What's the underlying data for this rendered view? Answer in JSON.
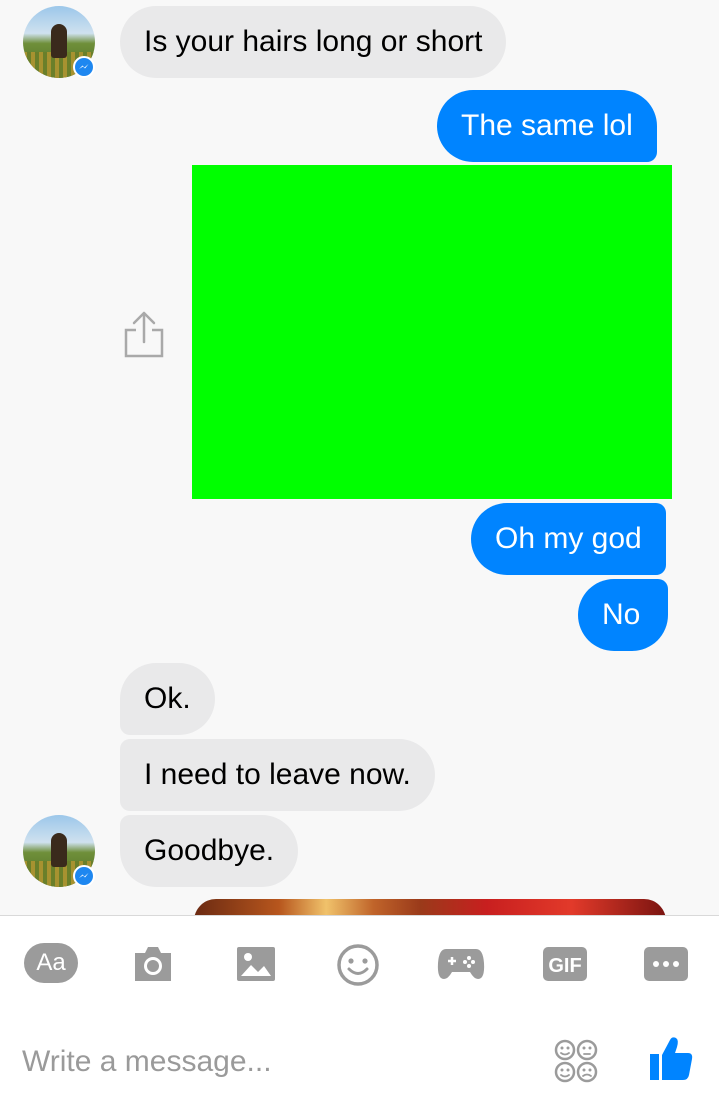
{
  "messages": [
    {
      "side": "in",
      "text": "Is your hairs long or short"
    },
    {
      "side": "out",
      "text": "The same lol"
    },
    {
      "side": "out",
      "text": "Oh my god"
    },
    {
      "side": "out",
      "text": "No"
    },
    {
      "side": "in",
      "text": "Ok."
    },
    {
      "side": "in",
      "text": "I need to leave now."
    },
    {
      "side": "in",
      "text": "Goodbye."
    }
  ],
  "composer": {
    "aa_label": "Aa",
    "gif_label": "GIF",
    "placeholder": "Write a message..."
  },
  "colors": {
    "outgoing": "#0084ff",
    "incoming": "#e9e9ea",
    "photo_placeholder": "#00ff00",
    "toolbar_icon": "#9b9b9b",
    "like": "#0084ff"
  },
  "icons": [
    "camera-icon",
    "image-icon",
    "emoji-icon",
    "game-icon",
    "gif-icon",
    "more-icon",
    "stickers-icon",
    "like-icon",
    "share-icon",
    "messenger-badge-icon"
  ]
}
